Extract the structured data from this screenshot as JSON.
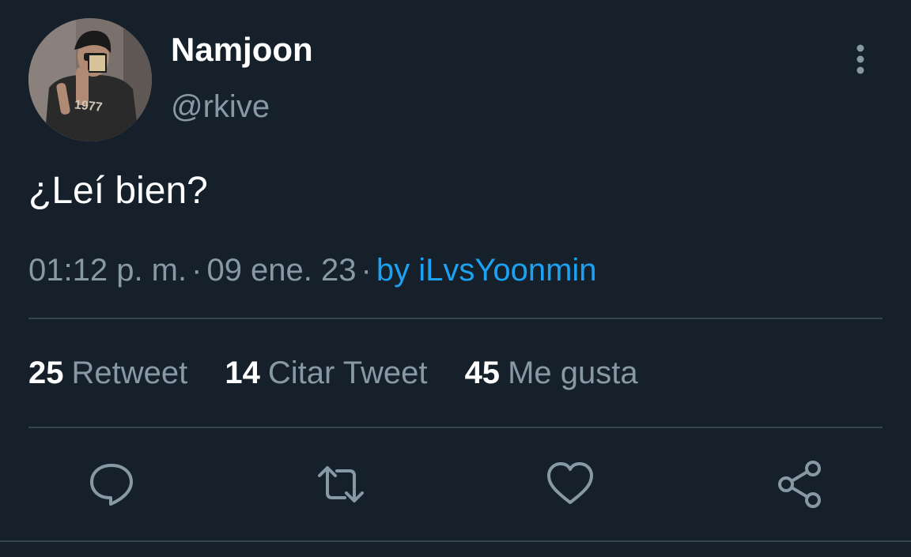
{
  "user": {
    "display_name": "Namjoon",
    "handle": "@rkive",
    "avatar_shirt_text": "1977"
  },
  "tweet": {
    "text": "¿Leí bien?",
    "time": "01:12 p. m.",
    "date": "09 ene. 23",
    "separator": "·",
    "source": "by iLvsYoonmin"
  },
  "stats": {
    "retweets": {
      "count": "25",
      "label": "Retweet"
    },
    "quotes": {
      "count": "14",
      "label": "Citar Tweet"
    },
    "likes": {
      "count": "45",
      "label": "Me gusta"
    }
  },
  "icons": {
    "more": "more-vertical-icon",
    "reply": "reply-icon",
    "retweet": "retweet-icon",
    "like": "heart-icon",
    "share": "share-icon"
  },
  "colors": {
    "background": "#15202b",
    "secondary_text": "#8899a6",
    "link": "#1da1f2",
    "divider": "#38444d",
    "icon": "#8899a6"
  }
}
